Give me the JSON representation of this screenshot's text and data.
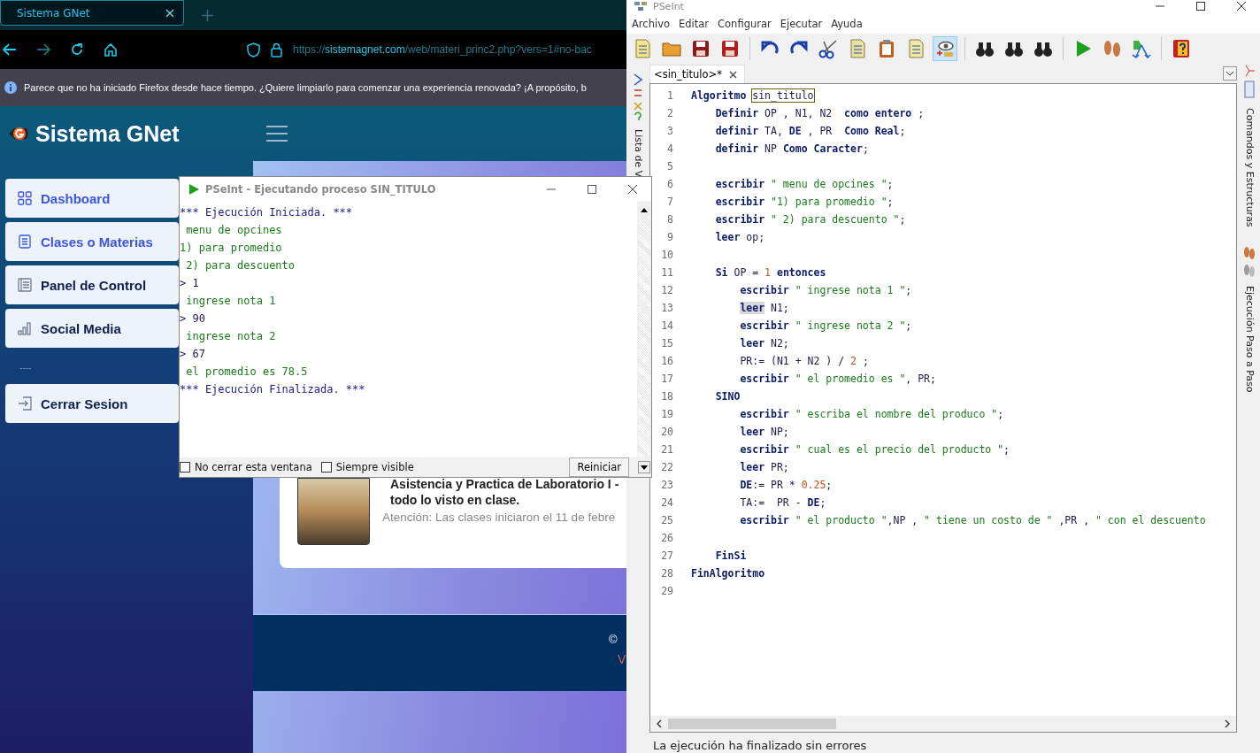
{
  "browser": {
    "tab": {
      "title": "Sistema GNet",
      "selected": true
    },
    "url": {
      "scheme": "https://",
      "domain": "sistemagnet.com",
      "path": "/web/materi_princ2.php?vers=1#no-bac"
    },
    "notification": "Parece que no ha iniciado Firefox desde hace tiempo. ¿Quiere limpiarlo para comenzar una experiencia renovada? ¡A propósito, b",
    "site": {
      "brand": "Sistema GNet",
      "menu": [
        {
          "label": "Dashboard",
          "selected": true
        },
        {
          "label": "Clases o Materias",
          "selected": true
        },
        {
          "label": "Panel de Control",
          "selected": false
        },
        {
          "label": "Social Media",
          "selected": false
        }
      ],
      "separator": "----",
      "logout": {
        "label": "Cerrar Sesion"
      },
      "card": {
        "title": "Asistencia y Practica de Laboratorio I -",
        "title_line_2": "todo lo visto en clase.",
        "note": "Atención: Las clases iniciaron el 11 de febre"
      },
      "footer": {
        "copyright": "©",
        "link": "V"
      }
    }
  },
  "editor": {
    "title": "PSeInt",
    "menu": [
      "Archivo",
      "Editar",
      "Configurar",
      "Ejecutar",
      "Ayuda"
    ],
    "file_tab": "<sin_titulo>*",
    "left_panel": "Lista de V",
    "right_panels": [
      "Comandos y Estructuras",
      "Ejecución Paso a Paso"
    ],
    "lines": [
      {
        "n": "1",
        "tokens": [
          {
            "kind": "keyword",
            "text": "Algoritmo "
          },
          {
            "kind": "match",
            "text": "sin_titulo"
          }
        ]
      },
      {
        "n": "2",
        "tokens": [
          {
            "kind": "keyword",
            "text": "    Definir"
          },
          {
            "kind": "text",
            "text": " OP , N1, N2  "
          },
          {
            "kind": "keyword",
            "text": "como entero"
          },
          {
            "kind": "text",
            "text": " ;"
          }
        ]
      },
      {
        "n": "3",
        "tokens": [
          {
            "kind": "keyword",
            "text": "    definir"
          },
          {
            "kind": "text",
            "text": " TA, "
          },
          {
            "kind": "keyword",
            "text": "DE"
          },
          {
            "kind": "text",
            "text": " , PR  "
          },
          {
            "kind": "keyword",
            "text": "Como Real"
          },
          {
            "kind": "text",
            "text": ";"
          }
        ]
      },
      {
        "n": "4",
        "tokens": [
          {
            "kind": "keyword",
            "text": "    definir"
          },
          {
            "kind": "text",
            "text": " NP "
          },
          {
            "kind": "keyword",
            "text": "Como Caracter"
          },
          {
            "kind": "text",
            "text": ";"
          }
        ]
      },
      {
        "n": "5"
      },
      {
        "n": "6",
        "tokens": [
          {
            "kind": "keyword",
            "text": "    escribir"
          },
          {
            "kind": "string",
            "text": " \" menu de opcines \""
          },
          {
            "kind": "text",
            "text": ";"
          }
        ]
      },
      {
        "n": "7",
        "tokens": [
          {
            "kind": "keyword",
            "text": "    escribir"
          },
          {
            "kind": "string",
            "text": " \"1) para promedio \""
          },
          {
            "kind": "text",
            "text": ";"
          }
        ]
      },
      {
        "n": "8",
        "tokens": [
          {
            "kind": "keyword",
            "text": "    escribir"
          },
          {
            "kind": "string",
            "text": " \" 2) para descuento \""
          },
          {
            "kind": "text",
            "text": ";"
          }
        ]
      },
      {
        "n": "9",
        "tokens": [
          {
            "kind": "keyword",
            "text": "    leer"
          },
          {
            "kind": "text",
            "text": " op;"
          }
        ]
      },
      {
        "n": "10"
      },
      {
        "n": "11",
        "tokens": [
          {
            "kind": "keyword",
            "text": "    Si"
          },
          {
            "kind": "text",
            "text": " OP = "
          },
          {
            "kind": "number",
            "text": "1"
          },
          {
            "kind": "keyword",
            "text": " entonces"
          }
        ]
      },
      {
        "n": "12",
        "tokens": [
          {
            "kind": "keyword",
            "text": "        escribir"
          },
          {
            "kind": "string",
            "text": " \" ingrese nota 1 \""
          },
          {
            "kind": "text",
            "text": ";"
          }
        ]
      },
      {
        "n": "13",
        "tokens": [
          {
            "kind": "selection",
            "text": "        leer"
          },
          {
            "kind": "text",
            "text": " N1;"
          }
        ]
      },
      {
        "n": "14",
        "tokens": [
          {
            "kind": "keyword",
            "text": "        escribir"
          },
          {
            "kind": "string",
            "text": " \" ingrese nota 2 \""
          },
          {
            "kind": "text",
            "text": ";"
          }
        ]
      },
      {
        "n": "15",
        "tokens": [
          {
            "kind": "keyword",
            "text": "        leer"
          },
          {
            "kind": "text",
            "text": " N2;"
          }
        ]
      },
      {
        "n": "16",
        "tokens": [
          {
            "kind": "text",
            "text": "        PR:= (N1 + N2 ) / "
          },
          {
            "kind": "number",
            "text": "2"
          },
          {
            "kind": "text",
            "text": " ;"
          }
        ]
      },
      {
        "n": "17",
        "tokens": [
          {
            "kind": "keyword",
            "text": "        escribir"
          },
          {
            "kind": "string",
            "text": " \" el promedio es \""
          },
          {
            "kind": "text",
            "text": ", PR;"
          }
        ]
      },
      {
        "n": "18",
        "tokens": [
          {
            "kind": "keyword",
            "text": "    SINO"
          }
        ]
      },
      {
        "n": "19",
        "tokens": [
          {
            "kind": "keyword",
            "text": "        escribir"
          },
          {
            "kind": "string",
            "text": " \" escriba el nombre del produco \""
          },
          {
            "kind": "text",
            "text": ";"
          }
        ]
      },
      {
        "n": "20",
        "tokens": [
          {
            "kind": "keyword",
            "text": "        leer"
          },
          {
            "kind": "text",
            "text": " NP;"
          }
        ]
      },
      {
        "n": "21",
        "tokens": [
          {
            "kind": "keyword",
            "text": "        escribir"
          },
          {
            "kind": "string",
            "text": " \" cual es el precio del producto \""
          },
          {
            "kind": "text",
            "text": ";"
          }
        ]
      },
      {
        "n": "22",
        "tokens": [
          {
            "kind": "keyword",
            "text": "        leer"
          },
          {
            "kind": "text",
            "text": " PR;"
          }
        ]
      },
      {
        "n": "23",
        "tokens": [
          {
            "kind": "keyword",
            "text": "        DE"
          },
          {
            "kind": "text",
            "text": ":= PR * "
          },
          {
            "kind": "number",
            "text": "0.25"
          },
          {
            "kind": "text",
            "text": ";"
          }
        ]
      },
      {
        "n": "24",
        "tokens": [
          {
            "kind": "text",
            "text": "        TA:=  PR - "
          },
          {
            "kind": "keyword",
            "text": "DE"
          },
          {
            "kind": "text",
            "text": ";"
          }
        ]
      },
      {
        "n": "25",
        "tokens": [
          {
            "kind": "keyword",
            "text": "        escribir"
          },
          {
            "kind": "string",
            "text": " \" el producto \""
          },
          {
            "kind": "text",
            "text": ",NP , "
          },
          {
            "kind": "string",
            "text": "\" tiene un costo de \""
          },
          {
            "kind": "text",
            "text": " ,PR , "
          },
          {
            "kind": "string",
            "text": "\" con el descuento"
          }
        ]
      },
      {
        "n": "26"
      },
      {
        "n": "27",
        "tokens": [
          {
            "kind": "keyword",
            "text": "    FinSi"
          }
        ]
      },
      {
        "n": "28",
        "tokens": [
          {
            "kind": "keyword",
            "text": "FinAlgoritmo"
          }
        ]
      },
      {
        "n": "29"
      }
    ],
    "status": "La ejecución ha finalizado sin errores"
  },
  "console": {
    "title": "PSeInt - Ejecutando proceso SIN_TITULO",
    "lines": [
      {
        "kind": "banner",
        "text": "*** Ejecución Iniciada. ***"
      },
      {
        "kind": "output",
        "text": " menu de opcines"
      },
      {
        "kind": "output",
        "text": "1) para promedio"
      },
      {
        "kind": "output",
        "text": " 2) para descuento"
      },
      {
        "kind": "input",
        "text": "> 1"
      },
      {
        "kind": "output",
        "text": " ingrese nota 1"
      },
      {
        "kind": "input",
        "text": "> 90"
      },
      {
        "kind": "output",
        "text": " ingrese nota 2"
      },
      {
        "kind": "input",
        "text": "> 67"
      },
      {
        "kind": "output",
        "text": " el promedio es 78.5"
      },
      {
        "kind": "banner",
        "text": "*** Ejecución Finalizada. ***"
      }
    ],
    "options": [
      {
        "label": "No cerrar esta ventana",
        "checked": false
      },
      {
        "label": "Siempre visible",
        "checked": false
      }
    ],
    "restart": "Reiniciar"
  }
}
